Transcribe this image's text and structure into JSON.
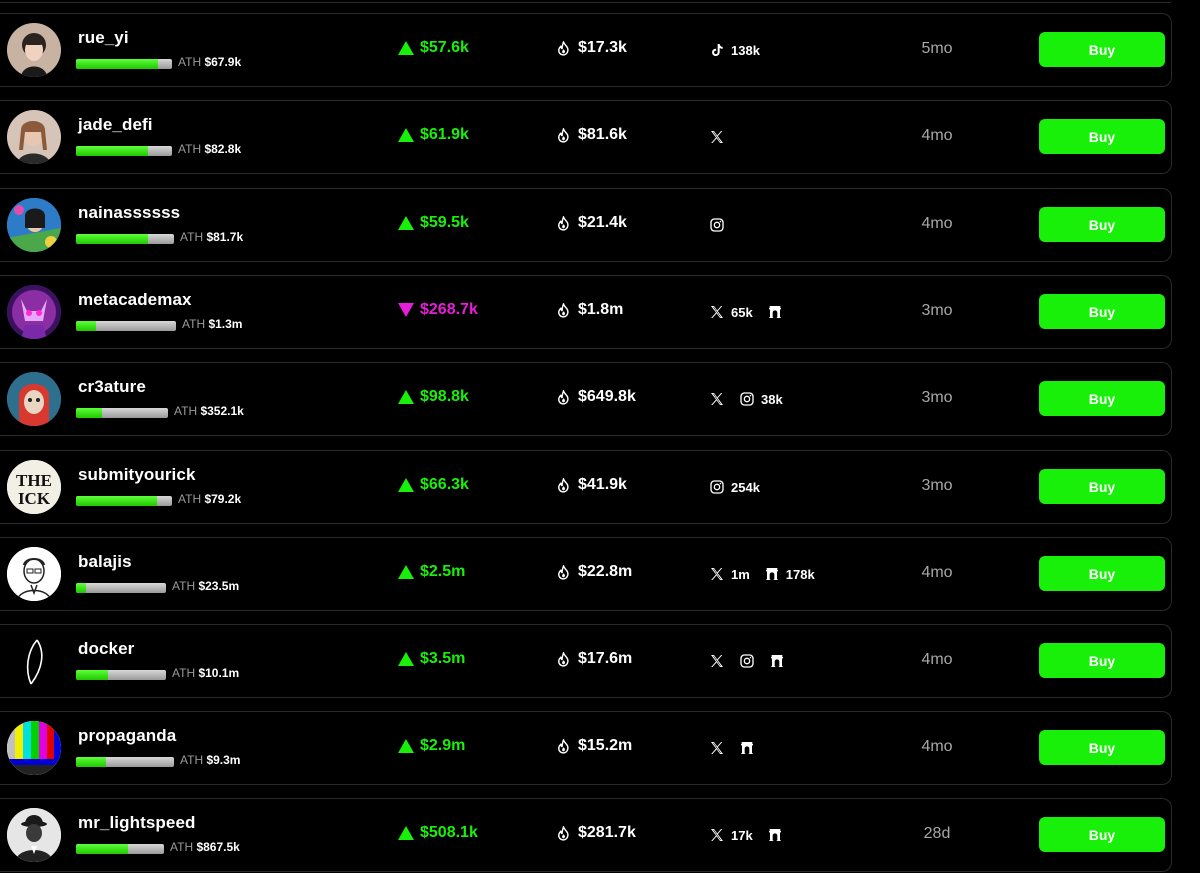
{
  "buy_label": "Buy",
  "ath_label": "ATH",
  "colors": {
    "up": "#19f00a",
    "down": "#e61ed8",
    "buy_bg": "#19f00a"
  },
  "rows": [
    {
      "name": "rue_yi",
      "ath": "$67.9k",
      "progress": 0.85,
      "trend": "up",
      "market_cap": "$57.6k",
      "volume": "$17.3k",
      "avatar_icon": "person-photo-avatar",
      "socials": [
        {
          "icon": "tiktok-icon",
          "count": "138k"
        }
      ],
      "age": "5mo"
    },
    {
      "name": "jade_defi",
      "ath": "$82.8k",
      "progress": 0.75,
      "trend": "up",
      "market_cap": "$61.9k",
      "volume": "$81.6k",
      "avatar_icon": "person-photo-avatar",
      "socials": [
        {
          "icon": "x-icon",
          "count": ""
        }
      ],
      "age": "4mo"
    },
    {
      "name": "nainassssss",
      "ath": "$81.7k",
      "progress": 0.73,
      "trend": "up",
      "market_cap": "$59.5k",
      "volume": "$21.4k",
      "avatar_icon": "person-photo-avatar",
      "socials": [
        {
          "icon": "instagram-icon",
          "count": ""
        }
      ],
      "age": "4mo"
    },
    {
      "name": "metacademax",
      "ath": "$1.3m",
      "progress": 0.2,
      "trend": "down",
      "market_cap": "$268.7k",
      "volume": "$1.8m",
      "avatar_icon": "character-avatar",
      "socials": [
        {
          "icon": "x-icon",
          "count": "65k"
        },
        {
          "icon": "farcaster-icon",
          "count": ""
        }
      ],
      "age": "3mo"
    },
    {
      "name": "cr3ature",
      "ath": "$352.1k",
      "progress": 0.28,
      "trend": "up",
      "market_cap": "$98.8k",
      "volume": "$649.8k",
      "avatar_icon": "character-avatar",
      "socials": [
        {
          "icon": "x-icon",
          "count": ""
        },
        {
          "icon": "instagram-icon",
          "count": "38k"
        }
      ],
      "age": "3mo"
    },
    {
      "name": "submityourick",
      "ath": "$79.2k",
      "progress": 0.84,
      "trend": "up",
      "market_cap": "$66.3k",
      "volume": "$41.9k",
      "avatar_icon": "the-ick-logo",
      "socials": [
        {
          "icon": "instagram-icon",
          "count": "254k"
        }
      ],
      "age": "3mo"
    },
    {
      "name": "balajis",
      "ath": "$23.5m",
      "progress": 0.11,
      "trend": "up",
      "market_cap": "$2.5m",
      "volume": "$22.8m",
      "avatar_icon": "sketch-portrait-avatar",
      "socials": [
        {
          "icon": "x-icon",
          "count": "1m"
        },
        {
          "icon": "farcaster-icon",
          "count": "178k"
        }
      ],
      "age": "4mo"
    },
    {
      "name": "docker",
      "ath": "$10.1m",
      "progress": 0.35,
      "trend": "up",
      "market_cap": "$3.5m",
      "volume": "$17.6m",
      "avatar_icon": "line-logo-avatar",
      "socials": [
        {
          "icon": "x-icon",
          "count": ""
        },
        {
          "icon": "instagram-icon",
          "count": ""
        },
        {
          "icon": "farcaster-icon",
          "count": ""
        }
      ],
      "age": "4mo"
    },
    {
      "name": "propaganda",
      "ath": "$9.3m",
      "progress": 0.31,
      "trend": "up",
      "market_cap": "$2.9m",
      "volume": "$15.2m",
      "avatar_icon": "tv-color-bars-avatar",
      "socials": [
        {
          "icon": "x-icon",
          "count": ""
        },
        {
          "icon": "farcaster-icon",
          "count": ""
        }
      ],
      "age": "4mo"
    },
    {
      "name": "mr_lightspeed",
      "ath": "$867.5k",
      "progress": 0.59,
      "trend": "up",
      "market_cap": "$508.1k",
      "volume": "$281.7k",
      "avatar_icon": "bowler-hat-avatar",
      "socials": [
        {
          "icon": "x-icon",
          "count": "17k"
        },
        {
          "icon": "farcaster-icon",
          "count": ""
        }
      ],
      "age": "28d"
    }
  ]
}
